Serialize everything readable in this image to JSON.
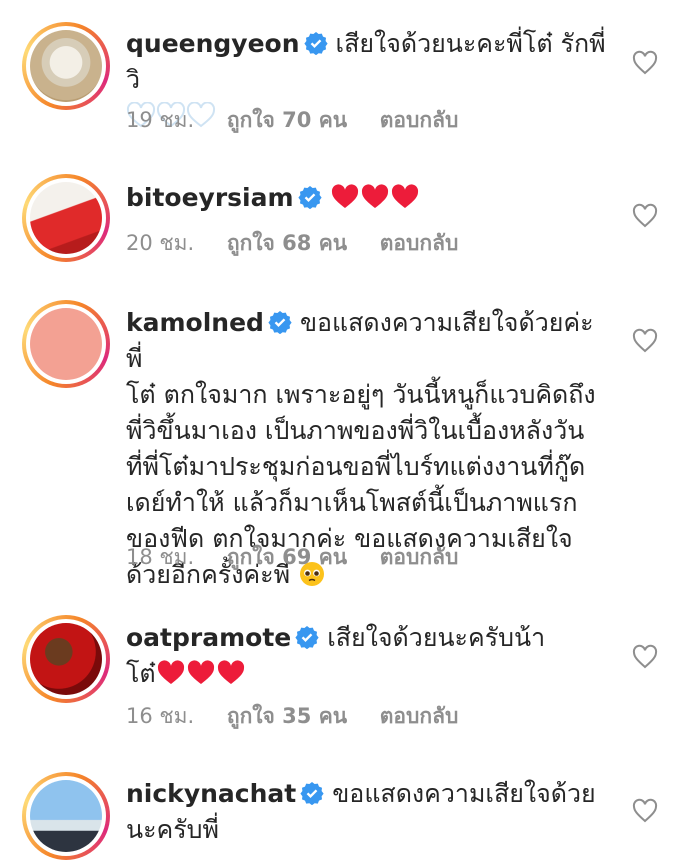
{
  "comments": [
    {
      "username": "queengyeon",
      "text": "เสียใจด้วยนะคะพี่โต๋ รักพี่วิ",
      "time": "19 ชม.",
      "likes": "ถูกใจ 70 คน",
      "reply": "ตอบกลับ",
      "emoji": "white-heart x3"
    },
    {
      "username": "bitoeyrsiam",
      "text": "",
      "time": "20 ชม.",
      "likes": "ถูกใจ 68 คน",
      "reply": "ตอบกลับ",
      "emoji": "red-heart x3"
    },
    {
      "username": "kamolned",
      "text_lines": [
        "ขอแสดงความเสียใจด้วยค่ะพี่",
        "โต๋ ตกใจมาก เพราะอยู่ๆ วันนี้หนูก็แวบคิดถึง",
        "พี่วิขึ้นมาเอง เป็นภาพของพี่วิในเบื้องหลังวัน",
        "ที่พี่โต๋มาประชุมก่อนขอพี่ไบร์ทแต่งงานที่กู๊ด",
        "เดย์ทำให้ แล้วก็มาเห็นโพสต์นี้เป็นภาพแรก",
        "ของฟีด ตกใจมากค่ะ ขอแสดงความเสียใจ",
        "ด้วยอีกครั้งค่ะพี่"
      ],
      "time": "18 ชม.",
      "likes": "ถูกใจ 69 คน",
      "reply": "ตอบกลับ",
      "emoji": "pleading-face"
    },
    {
      "username": "oatpramote",
      "text_lines": [
        "เสียใจด้วยนะครับน้า",
        "โต๋"
      ],
      "time": "16 ชม.",
      "likes": "ถูกใจ 35 คน",
      "reply": "ตอบกลับ",
      "emoji": "red-heart x3"
    },
    {
      "username": "nickynachat",
      "text_lines": [
        "ขอแสดงความเสียใจด้วย",
        "นะครับพี่"
      ],
      "time": "",
      "likes": "",
      "reply": ""
    }
  ],
  "colors": {
    "verified": "#3897f0",
    "heart_red": "#ed4956",
    "meta_gray": "#8e8e8e"
  }
}
